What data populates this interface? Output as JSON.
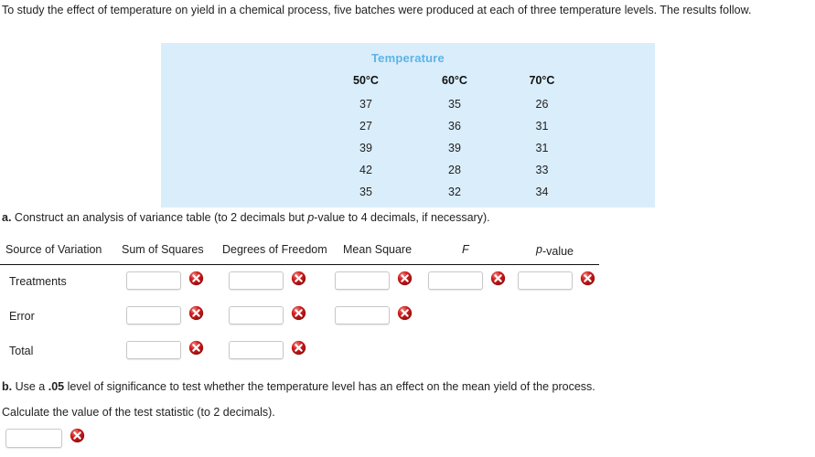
{
  "intro": {
    "text": "To study the effect of temperature on yield in a chemical process, five batches were produced at each of three temperature levels. The results follow."
  },
  "data_table": {
    "title": "Temperature",
    "headers": [
      "50°C",
      "60°C",
      "70°C"
    ],
    "rows": [
      [
        "37",
        "35",
        "26"
      ],
      [
        "27",
        "36",
        "31"
      ],
      [
        "39",
        "39",
        "31"
      ],
      [
        "42",
        "28",
        "33"
      ],
      [
        "35",
        "32",
        "34"
      ]
    ],
    "background_color": "#daedfb",
    "title_color": "#5cb4e8"
  },
  "part_a": {
    "label": "a.",
    "text": " Construct an analysis of variance table (to 2 decimals but ",
    "italic_p": "p",
    "text_tail": "-value to 4 decimals, if necessary)."
  },
  "anova": {
    "headers": {
      "source": "Source of Variation",
      "ss": "Sum of Squares",
      "df": "Degrees of Freedom",
      "ms": "Mean Square",
      "f": "F",
      "p_italic": "p",
      "p_rest": "-value"
    },
    "rows": [
      {
        "label": "Treatments",
        "inputs": [
          "",
          "",
          "",
          "",
          ""
        ]
      },
      {
        "label": "Error",
        "inputs": [
          "",
          "",
          ""
        ]
      },
      {
        "label": "Total",
        "inputs": [
          "",
          ""
        ]
      }
    ],
    "error_icon": "error-x-icon",
    "error_icon_color": "#cc1111"
  },
  "part_b": {
    "label": "b.",
    "text_pre": " Use a ",
    "bold_alpha": ".05",
    "text_post": " level of significance to test whether the temperature level has an effect on the mean yield of the process.",
    "line2": "Calculate the value of the test statistic (to 2 decimals)."
  },
  "final_answer": {
    "value": "",
    "error_icon": "error-x-icon"
  }
}
